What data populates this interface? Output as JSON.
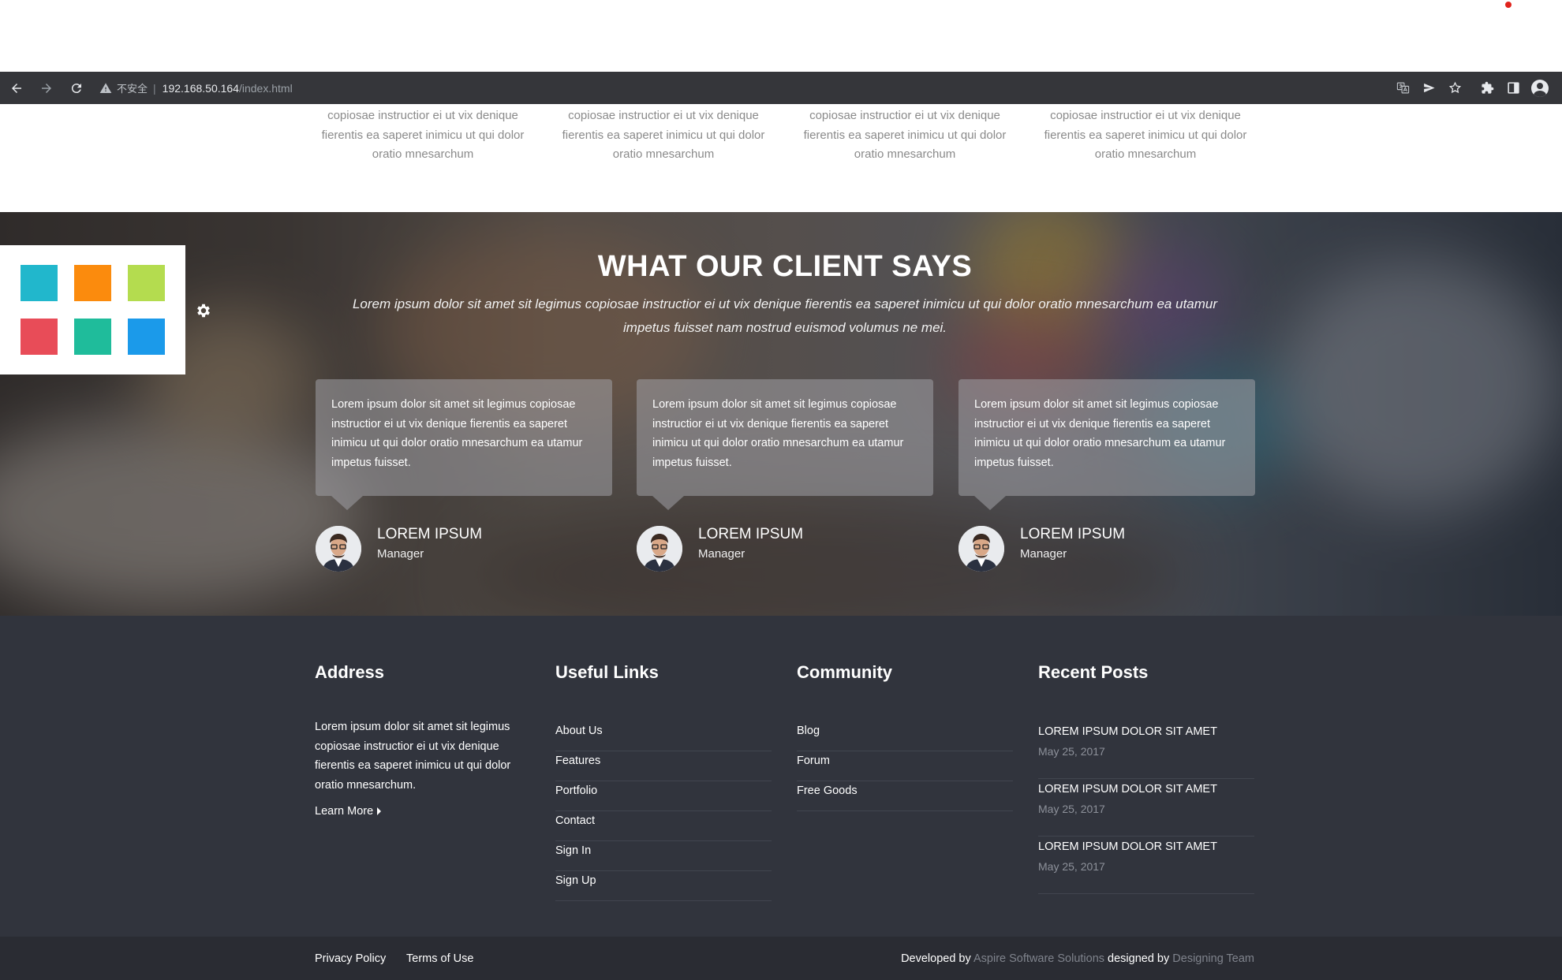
{
  "browser": {
    "insecure_label": "不安全",
    "url_host": "192.168.50.164",
    "url_path": "/index.html",
    "icons": [
      "back-icon",
      "forward-icon",
      "reload-icon",
      "warning-icon",
      "translate-icon",
      "send-icon",
      "bookmark-star-icon",
      "extensions-icon",
      "side-panel-icon",
      "profile-icon"
    ]
  },
  "features": {
    "columns": [
      {
        "text": "copiosae instructior ei ut vix denique fierentis ea saperet inimicu ut qui dolor oratio mnesarchum"
      },
      {
        "text": "copiosae instructior ei ut vix denique fierentis ea saperet inimicu ut qui dolor oratio mnesarchum"
      },
      {
        "text": "copiosae instructior ei ut vix denique fierentis ea saperet inimicu ut qui dolor oratio mnesarchum"
      },
      {
        "text": "copiosae instructior ei ut vix denique fierentis ea saperet inimicu ut qui dolor oratio mnesarchum"
      }
    ]
  },
  "style_switcher": {
    "colors": [
      "#21b7cc",
      "#fb8b0d",
      "#b4dc4f",
      "#e84c58",
      "#1fbc9b",
      "#1b9aea"
    ]
  },
  "testimonials": {
    "title": "WHAT OUR CLIENT SAYS",
    "subtitle": "Lorem ipsum dolor sit amet sit legimus copiosae instructior ei ut vix denique fierentis ea saperet inimicu ut qui dolor oratio mnesarchum ea utamur impetus fuisset nam nostrud euismod volumus ne mei.",
    "items": [
      {
        "quote": "Lorem ipsum dolor sit amet sit legimus copiosae instructior ei ut vix denique fierentis ea saperet inimicu ut qui dolor oratio mnesarchum ea utamur impetus fuisset.",
        "name": "LOREM IPSUM",
        "role": "Manager"
      },
      {
        "quote": "Lorem ipsum dolor sit amet sit legimus copiosae instructior ei ut vix denique fierentis ea saperet inimicu ut qui dolor oratio mnesarchum ea utamur impetus fuisset.",
        "name": "LOREM IPSUM",
        "role": "Manager"
      },
      {
        "quote": "Lorem ipsum dolor sit amet sit legimus copiosae instructior ei ut vix denique fierentis ea saperet inimicu ut qui dolor oratio mnesarchum ea utamur impetus fuisset.",
        "name": "LOREM IPSUM",
        "role": "Manager"
      }
    ]
  },
  "footer": {
    "address": {
      "title": "Address",
      "text": "Lorem ipsum dolor sit amet sit legimus copiosae instructior ei ut vix denique fierentis ea saperet inimicu ut qui dolor oratio mnesarchum.",
      "learn_more": "Learn More"
    },
    "useful_links": {
      "title": "Useful Links",
      "items": [
        "About Us",
        "Features",
        "Portfolio",
        "Contact",
        "Sign In",
        "Sign Up"
      ]
    },
    "community": {
      "title": "Community",
      "items": [
        "Blog",
        "Forum",
        "Free Goods"
      ]
    },
    "recent_posts": {
      "title": "Recent Posts",
      "items": [
        {
          "title": "LOREM IPSUM DOLOR SIT AMET",
          "date": "May 25, 2017"
        },
        {
          "title": "LOREM IPSUM DOLOR SIT AMET",
          "date": "May 25, 2017"
        },
        {
          "title": "LOREM IPSUM DOLOR SIT AMET",
          "date": "May 25, 2017"
        }
      ]
    }
  },
  "bottom_bar": {
    "privacy": "Privacy Policy",
    "terms": "Terms of Use",
    "developed_by": "Developed by",
    "developer": "Aspire Software Solutions",
    "designed_by": "designed by",
    "designer": "Designing Team"
  }
}
